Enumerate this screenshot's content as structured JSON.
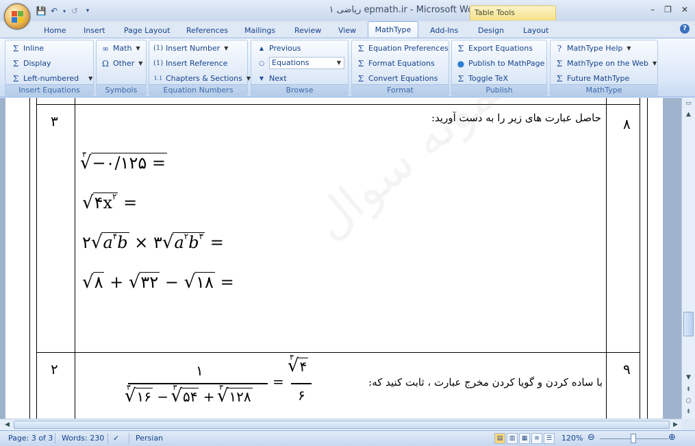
{
  "window": {
    "title": "ریاضی ۱  epmath.ir - Microsoft Word",
    "contextual_tab": "Table Tools",
    "controls": [
      "–",
      "❐",
      "✕"
    ]
  },
  "tabs": [
    "Home",
    "Insert",
    "Page Layout",
    "References",
    "Mailings",
    "Review",
    "View",
    "MathType",
    "Add-Ins",
    "Design",
    "Layout"
  ],
  "active_tab": "MathType",
  "ribbon": {
    "insert_equations": {
      "title": "Insert Equations",
      "inline": "Inline",
      "display": "Display",
      "left_numbered": "Left-numbered"
    },
    "symbols": {
      "title": "Symbols",
      "math": "Math",
      "other": "Other"
    },
    "equation_numbers": {
      "title": "Equation Numbers",
      "insert_number": "Insert Number",
      "insert_reference": "Insert Reference",
      "chapters_sections": "Chapters & Sections"
    },
    "browse": {
      "title": "Browse",
      "previous": "Previous",
      "combo_value": "Equations",
      "next": "Next"
    },
    "format": {
      "title": "Format",
      "equation_preferences": "Equation Preferences",
      "format_equations": "Format Equations",
      "convert_equations": "Convert Equations"
    },
    "publish": {
      "title": "Publish",
      "export_equations": "Export Equations",
      "publish_mathpage": "Publish to MathPage",
      "toggle_tex": "Toggle TeX"
    },
    "mathtype": {
      "title": "MathType",
      "help": "MathType Help",
      "on_web": "MathType on the Web",
      "future": "Future MathType"
    }
  },
  "document": {
    "row1": {
      "number": "۸",
      "score": "۳",
      "instruction": "حاصل عبارت های زیر را به دست آورید:"
    },
    "row2": {
      "number": "۹",
      "score": "۲",
      "instruction": "با ساده کردن و گویا کردن مخرج عبارت ، ثابت کنید که:"
    },
    "equations": {
      "e1": "−۰/۱۲۵ =",
      "e2_base": "۴x",
      "e2_exp": "۲",
      "e3": "=",
      "frac_num": "۱",
      "frac_rhs_rad": "۴",
      "frac_rhs_den": "۶",
      "frac_den_a": "۱۶",
      "frac_den_b": "۵۴",
      "frac_den_c": "۱۲۸"
    }
  },
  "statusbar": {
    "page": "Page: 3 of 3",
    "words": "Words: 230",
    "language": "Persian",
    "zoom": "120%"
  }
}
